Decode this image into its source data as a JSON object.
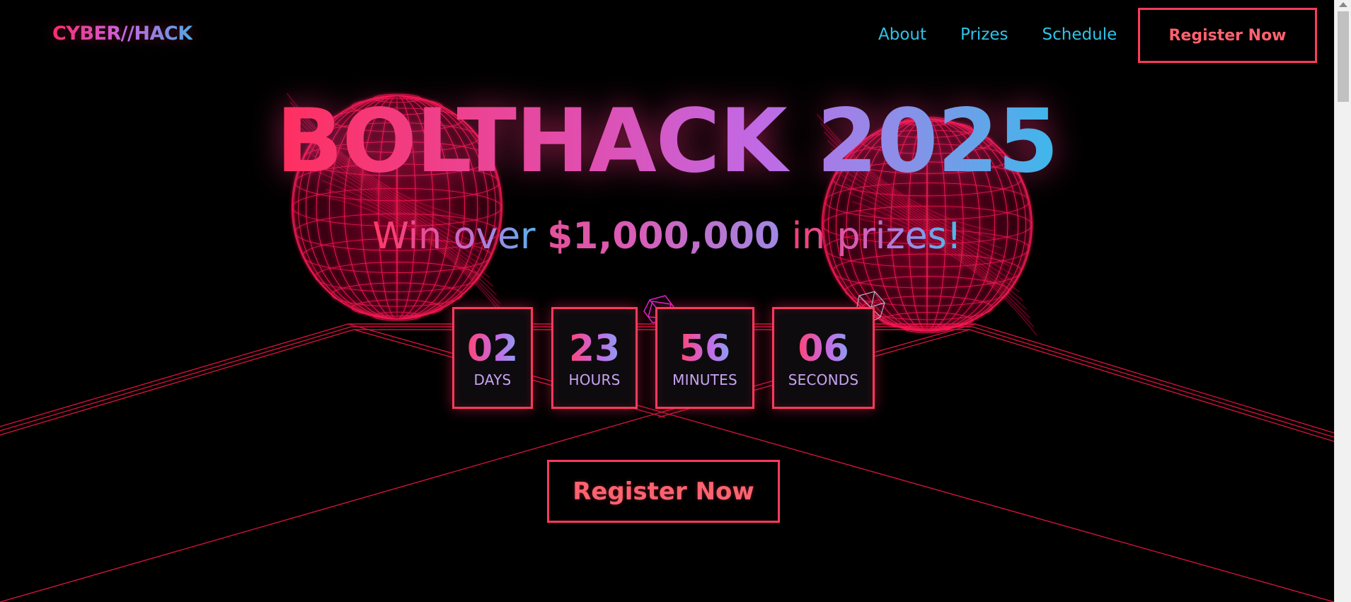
{
  "nav": {
    "logo": "CYBER//HACK",
    "links": [
      "About",
      "Prizes",
      "Schedule"
    ],
    "cta": "Register Now"
  },
  "hero": {
    "title": "BOLTHACK 2025",
    "subtitle_pre": "Win over ",
    "subtitle_amount": "$1,000,000",
    "subtitle_post": " in prizes!"
  },
  "countdown": [
    {
      "value": "02",
      "label": "DAYS"
    },
    {
      "value": "23",
      "label": "HOURS"
    },
    {
      "value": "56",
      "label": "MINUTES"
    },
    {
      "value": "06",
      "label": "SECONDS"
    }
  ],
  "cta": {
    "label": "Register Now"
  },
  "colors": {
    "accent": "#ff3a5c",
    "link": "#2ec4e8",
    "wireframe": "#e0184a",
    "background": "#000000"
  },
  "icons": [
    "wireframe-sphere-icon",
    "wireframe-sphere-icon",
    "wireframe-gem-icon",
    "wireframe-gem-icon"
  ]
}
